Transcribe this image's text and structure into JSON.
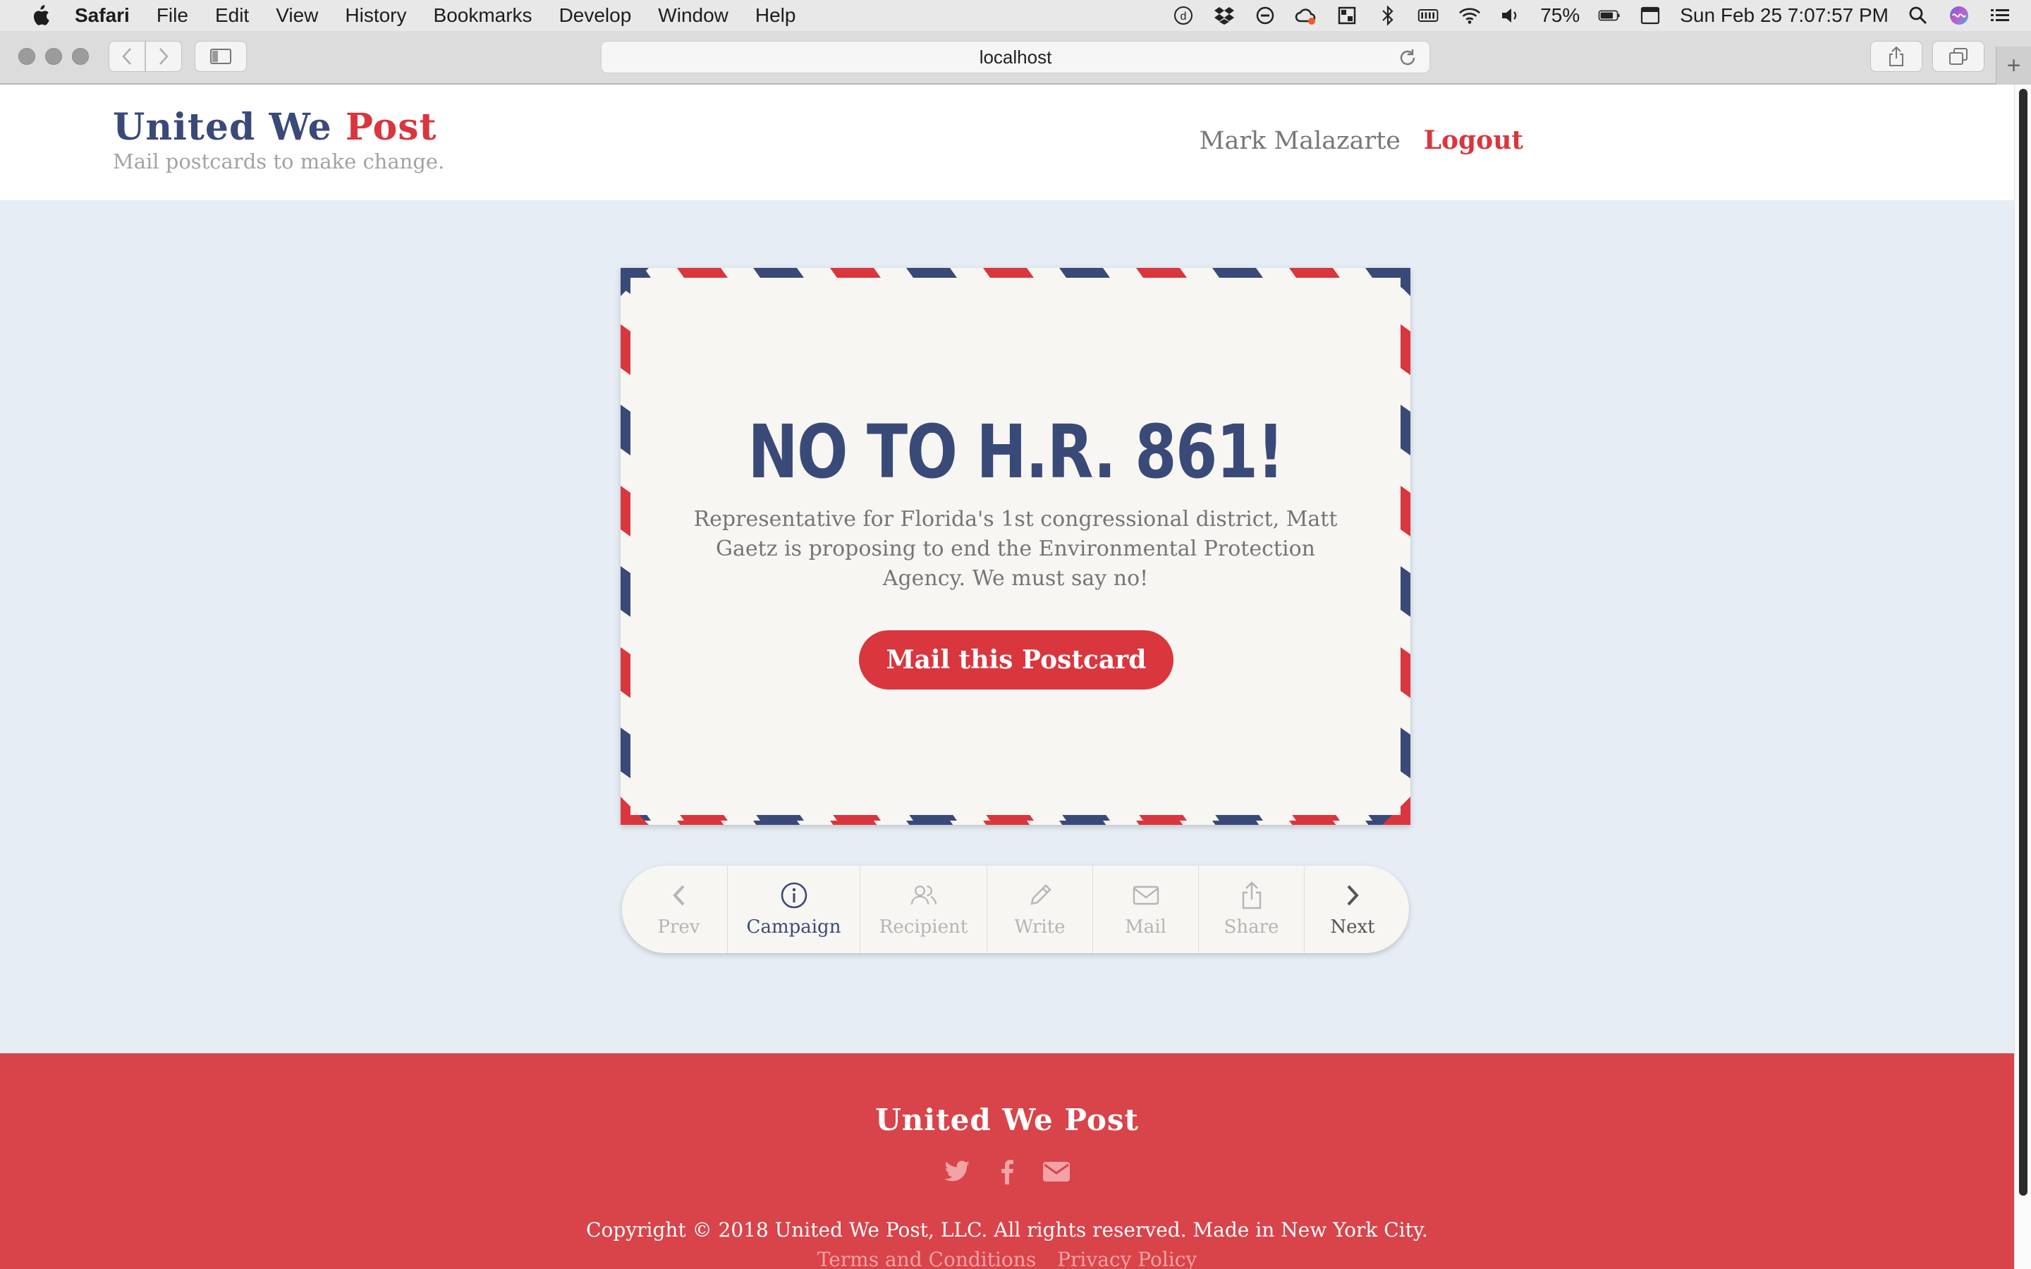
{
  "menubar": {
    "app_name": "Safari",
    "items": [
      "File",
      "Edit",
      "View",
      "History",
      "Bookmarks",
      "Develop",
      "Window",
      "Help"
    ],
    "battery": "75%",
    "datetime": "Sun Feb 25  7:07:57 PM",
    "status_icons": [
      "d-icon",
      "dropbox-icon",
      "minus-circle-icon",
      "cloud-sync-icon",
      "grid-icon",
      "bluetooth-icon",
      "battery-meter-icon",
      "wifi-icon",
      "volume-icon",
      "battery-icon",
      "keyboard-icon",
      "search-icon",
      "siri-icon",
      "list-icon"
    ]
  },
  "browser": {
    "url": "localhost"
  },
  "header": {
    "logo_part1": "United We",
    "logo_part2": "Post",
    "tagline": "Mail postcards to make change.",
    "user_name": "Mark Malazarte",
    "logout_label": "Logout"
  },
  "postcard": {
    "headline": "NO TO H.R. 861!",
    "description": "Representative for Florida's 1st congressional district, Matt Gaetz is proposing to end the Environmental Protection Agency. We must say no!",
    "button_label": "Mail this Postcard"
  },
  "stepper": {
    "prev": "Prev",
    "campaign": "Campaign",
    "recipient": "Recipient",
    "write": "Write",
    "mail": "Mail",
    "share": "Share",
    "next": "Next"
  },
  "footer": {
    "logo": "United We Post",
    "copyright": "Copyright © 2018 United We Post, LLC. All rights reserved. Made in New York City.",
    "terms": "Terms and Conditions",
    "privacy": "Privacy Policy"
  },
  "colors": {
    "navy": "#3a4a78",
    "red": "#d9363e",
    "page_bg": "#e6edf4",
    "card_bg": "#f8f6f2",
    "footer_bg": "#d9434a"
  }
}
